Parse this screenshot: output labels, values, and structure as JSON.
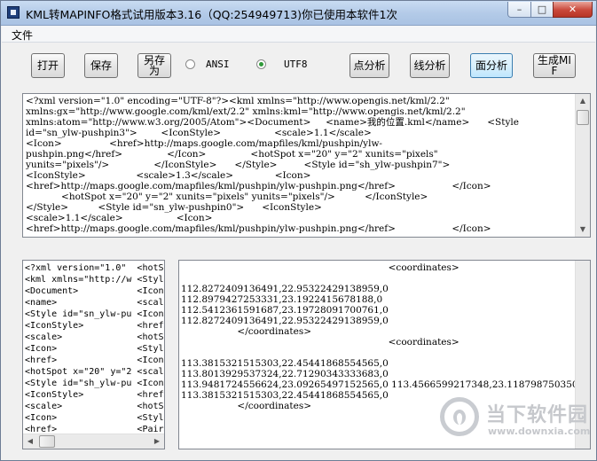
{
  "window": {
    "title": "KML转MAPINFO格式试用版本3.16（QQ:254949713)你已使用本软件1次",
    "controls": {
      "minimize": "–",
      "maximize": "□",
      "close": "✕"
    }
  },
  "menu": {
    "file": "文件"
  },
  "toolbar": {
    "open": "打开",
    "save": "保存",
    "save_as_1": "另存",
    "save_as_2": "为",
    "ansi": "ANSI",
    "utf8": "UTF8",
    "encoding_selected": "UTF8",
    "point_analysis": "点分析",
    "line_analysis": "线分析",
    "area_analysis": "面分析",
    "generate_mif_1": "生成MI",
    "generate_mif_2": "F"
  },
  "source_text": "<?xml version=\"1.0\" encoding=\"UTF-8\"?><kml xmlns=\"http://www.opengis.net/kml/2.2\"\nxmlns:gx=\"http://www.google.com/kml/ext/2.2\" xmlns:kml=\"http://www.opengis.net/kml/2.2\"\nxmlns:atom=\"http://www.w3.org/2005/Atom\"><Document>     <name>我的位置.kml</name>      <Style\nid=\"sn_ylw-pushpin3\">        <IconStyle>                  <scale>1.1</scale>\n<Icon>                <href>http://maps.google.com/mapfiles/kml/pushpin/ylw-\npushpin.png</href>               </Icon>               <hotSpot x=\"20\" y=\"2\" xunits=\"pixels\"\nyunits=\"pixels\"/>               </IconStyle>      </Style>         <Style id=\"sh_ylw-pushpin7\">\n<IconStyle>                 <scale>1.3</scale>              <Icon>\n<href>http://maps.google.com/mapfiles/kml/pushpin/ylw-pushpin.png</href>                   </Icon>\n            <hotSpot x=\"20\" y=\"2\" xunits=\"pixels\" yunits=\"pixels\"/>          </IconStyle>\n</Style>          <Style id=\"sn_ylw-pushpin0\">      <IconStyle>\n<scale>1.1</scale>                  <Icon>\n<href>http://maps.google.com/mapfiles/kml/pushpin/ylw-pushpin.png</href>                   </Icon>",
  "left_list": "<?xml version=\"1.0\"  <hotSp\n<kml xmlns=\"http://w <Style\n<Document>           <IconS\n<name>               <scale\n<Style id=\"sn_ylw-pu <Icon>\n<IconStyle>          <href>\n<scale>              <hotSp\n<Icon>               <Style\n<href>               <IconS\n<hotSpot x=\"20\" y=\"2 <scale\n<Style id=\"sh_ylw-pu <Icon>\n<IconStyle>          <href>\n<scale>              <hotSp\n<Icon>               <Style\n<href>               <Pair>",
  "coords_text": "                                                                      <coordinates>\n\n112.8272409136491,22.95322429138959,0\n112.8979427253331,23.1922415678188,0\n112.5412361591687,23.19728091700761,0\n112.8272409136491,22.95322429138959,0\n                   </coordinates>\n                                                                      <coordinates>\n\n113.3815321515303,22.45441868554565,0\n113.8013929537324,22.71290343333683,0\n113.9481724556624,23.09265497152565,0 113.4566599217348,23.1187987503508,0\n113.3815321515303,22.45441868554565,0\n                   </coordinates>",
  "watermark": {
    "name": "当下软件园",
    "url": "www.downxia.com"
  }
}
